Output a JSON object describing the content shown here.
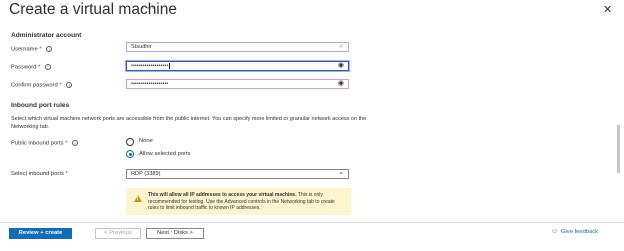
{
  "header": {
    "title": "Create a virtual machine",
    "more": "···",
    "close": "✕"
  },
  "admin": {
    "heading": "Administrator account",
    "username_label": "Username",
    "username_value": "Stsudhir",
    "password_label": "Password",
    "password_value": "•••••••••••••••••••",
    "confirm_label": "Confirm password",
    "confirm_value": "•••••••••••••••••••",
    "required_mark": "*",
    "info_glyph": "i"
  },
  "inbound": {
    "heading": "Inbound port rules",
    "description": "Select which virtual machine network ports are accessible from the public internet. You can specify more limited or granular network access on the Networking tab.",
    "public_label": "Public inbound ports",
    "option_none": "None",
    "option_allow": "Allow selected ports",
    "selected_option": "Allow selected ports",
    "select_label": "Select inbound ports",
    "select_value": "RDP (3389)",
    "warning_bold": "This will allow all IP addresses to access your virtual machine.",
    "warning_rest": " This is only recommended for testing.  Use the Advanced controls in the Networking tab to create rules to limit inbound traffic to known IP addresses."
  },
  "footer": {
    "review_create": "Review + create",
    "previous": "< Previous",
    "next": "Next : Disks >",
    "feedback": "Give feedback"
  },
  "colors": {
    "accent": "#0f6cbd",
    "field_border": "#c6a0dd",
    "warning_bg": "#fff4ce"
  }
}
